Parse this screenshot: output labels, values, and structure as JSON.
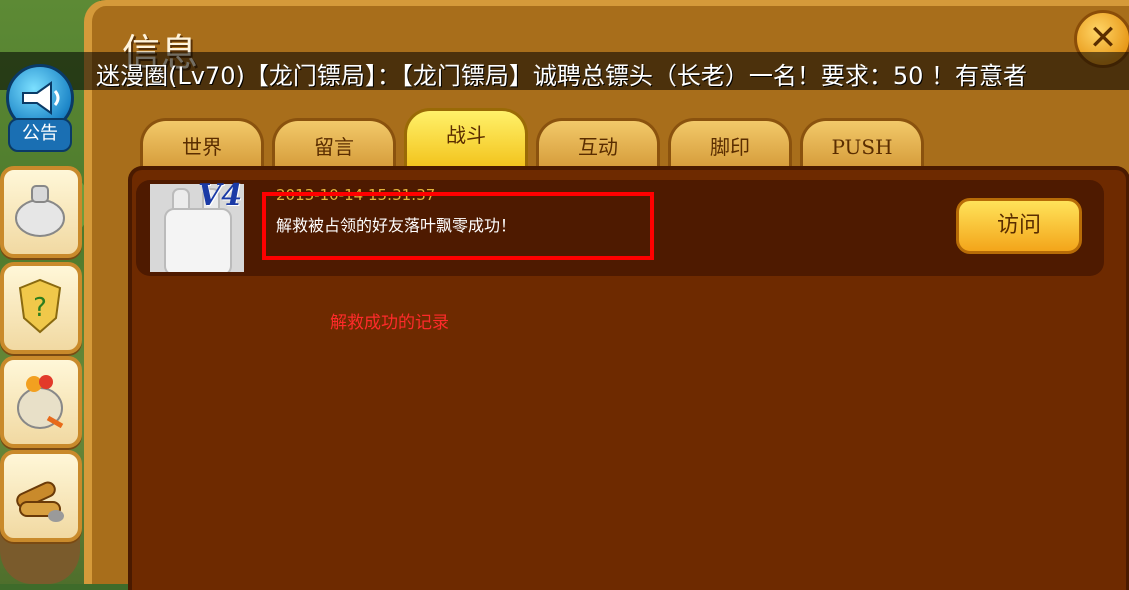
{
  "window": {
    "title": "信息",
    "close_label": "✕"
  },
  "ticker": {
    "text": "迷漫圈(Lv70)【龙门镖局】：【龙门镖局】诚聘总镖头（长老）一名！要求：50 ！有意者"
  },
  "announcement": {
    "label": "公告"
  },
  "tabs": [
    {
      "label": "世界",
      "active": false
    },
    {
      "label": "留言",
      "active": false
    },
    {
      "label": "战斗",
      "active": true
    },
    {
      "label": "互动",
      "active": false
    },
    {
      "label": "脚印",
      "active": false
    },
    {
      "label": "PUSH",
      "active": false
    }
  ],
  "records": [
    {
      "vip": "V4",
      "timestamp": "2013-10-14 15:31:37",
      "message": "解救被占领的好友落叶飘零成功！",
      "action_label": "访问"
    }
  ],
  "annotation": {
    "text": "解救成功的记录"
  },
  "colors": {
    "highlight": "#ff0000",
    "annotation": "#ff2a2a",
    "content_bg": "#6e2a00"
  }
}
